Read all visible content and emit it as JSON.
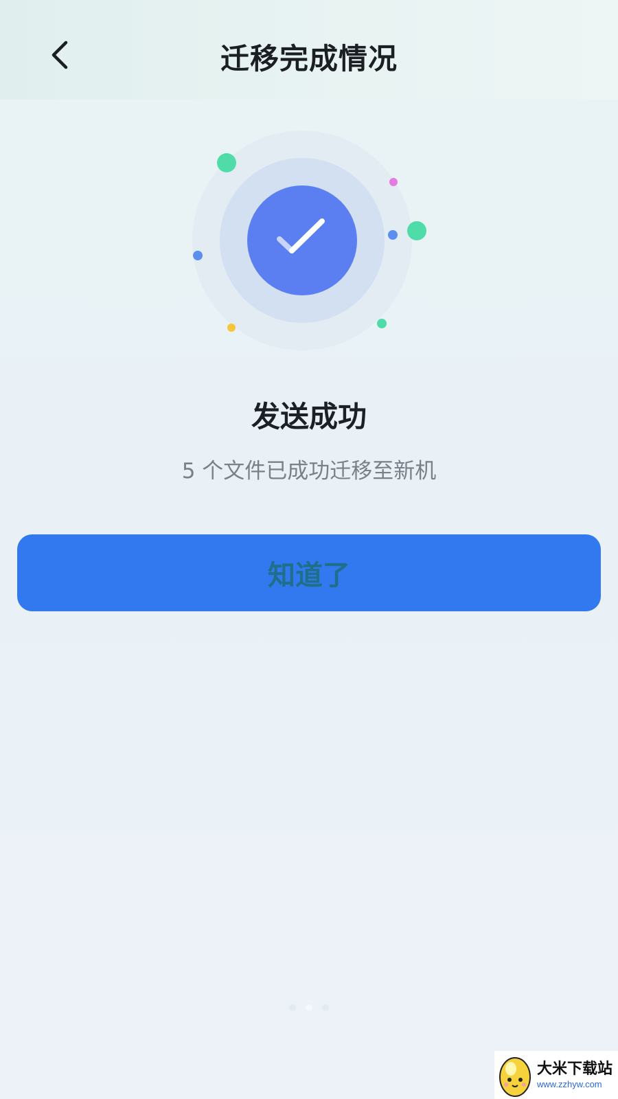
{
  "header": {
    "title": "迁移完成情况",
    "back_icon": "chevron-left-icon"
  },
  "result": {
    "icon": "check-icon",
    "title": "发送成功",
    "subtitle": "5 个文件已成功迁移至新机"
  },
  "actions": {
    "confirm_label": "知道了"
  },
  "watermark": {
    "name": "大米下载站",
    "url": "www.zzhyw.com"
  },
  "colors": {
    "primary": "#3279ef",
    "check_circle": "#5b7ff0",
    "accent_green": "#4fdca8",
    "accent_blue": "#5a8ff0",
    "accent_pink": "#e57be0",
    "accent_yellow": "#f5c63a"
  }
}
